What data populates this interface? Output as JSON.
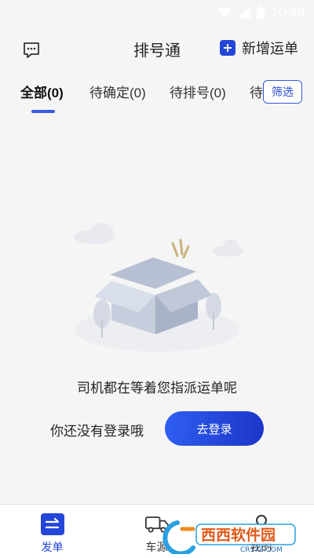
{
  "status_bar": {
    "time": "10:46"
  },
  "header": {
    "title": "排号通",
    "add_order_label": "新增运单"
  },
  "tabs": [
    {
      "label": "全部(0)"
    },
    {
      "label": "待确定(0)"
    },
    {
      "label": "待排号(0)"
    },
    {
      "label": "待"
    }
  ],
  "filter_label": "筛选",
  "empty_state": {
    "message": "司机都在等着您指派运单呢",
    "login_hint": "你还没有登录哦",
    "login_button": "去登录"
  },
  "bottom_nav": [
    {
      "label": "发单",
      "icon": "send-order-icon",
      "active": true
    },
    {
      "label": "车源",
      "icon": "truck-icon",
      "active": false
    },
    {
      "label": "我的",
      "icon": "profile-icon",
      "active": false
    }
  ],
  "watermark": {
    "brand": "西西软件园",
    "domain": "CR173.COM"
  },
  "colors": {
    "accent": "#2446d8",
    "background": "#f5f5f5"
  }
}
